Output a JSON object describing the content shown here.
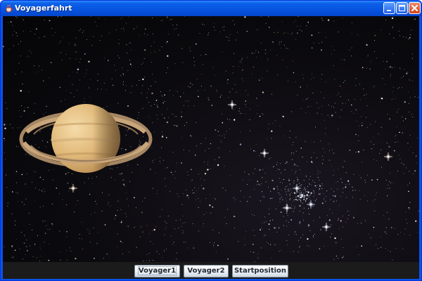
{
  "window": {
    "title": "Voyagerfahrt"
  },
  "buttons": [
    {
      "label": "Voyager1"
    },
    {
      "label": "Voyager2"
    },
    {
      "label": "Startposition"
    }
  ],
  "icons": {
    "app": "coffee-cup-icon",
    "minimize": "minimize-icon",
    "maximize": "maximize-icon",
    "close": "close-icon",
    "planet": "saturn-icon"
  },
  "colors": {
    "titlebar": "#0655e2",
    "close": "#d4441a",
    "space": "#050507",
    "buttonbar": "#1b1b1b",
    "planet": "#e3c08a",
    "rings": "#c8a57a"
  }
}
